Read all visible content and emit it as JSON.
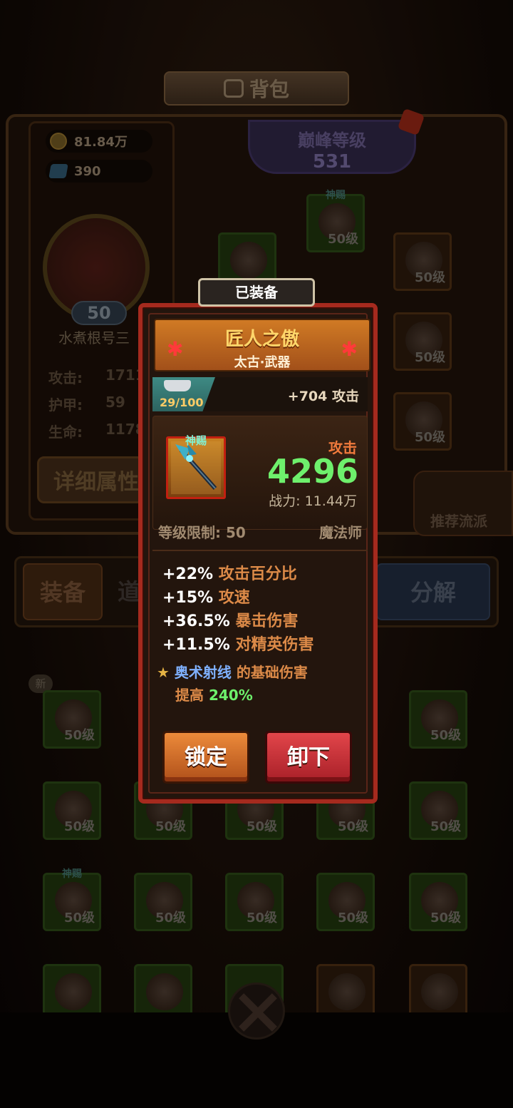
{
  "header": {
    "title": "背包"
  },
  "resources": {
    "gold": "81.84万",
    "gems": "390"
  },
  "player": {
    "level": "50",
    "name": "水煮根号三"
  },
  "stats": [
    {
      "label": "攻击:",
      "value": "1711"
    },
    {
      "label": "护甲:",
      "value": "59"
    },
    {
      "label": "生命:",
      "value": "1178"
    }
  ],
  "detail_button": "详细属性",
  "peak": {
    "title": "巅峰等级",
    "value": "531"
  },
  "recommend_label": "推荐流派",
  "tabs": {
    "equip": "装备",
    "items": "道",
    "decompose": "分解"
  },
  "new_tag": "新",
  "slot_level": "50级",
  "slot_tag": "神赐",
  "popup": {
    "equipped_label": "已装备",
    "item_name": "匠人之傲",
    "item_subtitle": "太古·武器",
    "enhance_count": "29/100",
    "enhance_bonus": "+704 攻击",
    "icon_tag": "神赐",
    "main_stat_label": "攻击",
    "main_stat_value": "4296",
    "power": "战力: 11.44万",
    "level_req": "等级限制: 50",
    "class": "魔法师",
    "attributes": [
      {
        "value": "+22%",
        "name": "攻击百分比"
      },
      {
        "value": "+15%",
        "name": "攻速"
      },
      {
        "value": "+36.5%",
        "name": "暴击伤害"
      },
      {
        "value": "+11.5%",
        "name": "对精英伤害"
      }
    ],
    "skill": {
      "star": "★",
      "name": "奥术射线",
      "text1": " 的基础伤害",
      "text2": "提高 ",
      "percent": "240%"
    },
    "lock_button": "锁定",
    "unequip_button": "卸下"
  }
}
